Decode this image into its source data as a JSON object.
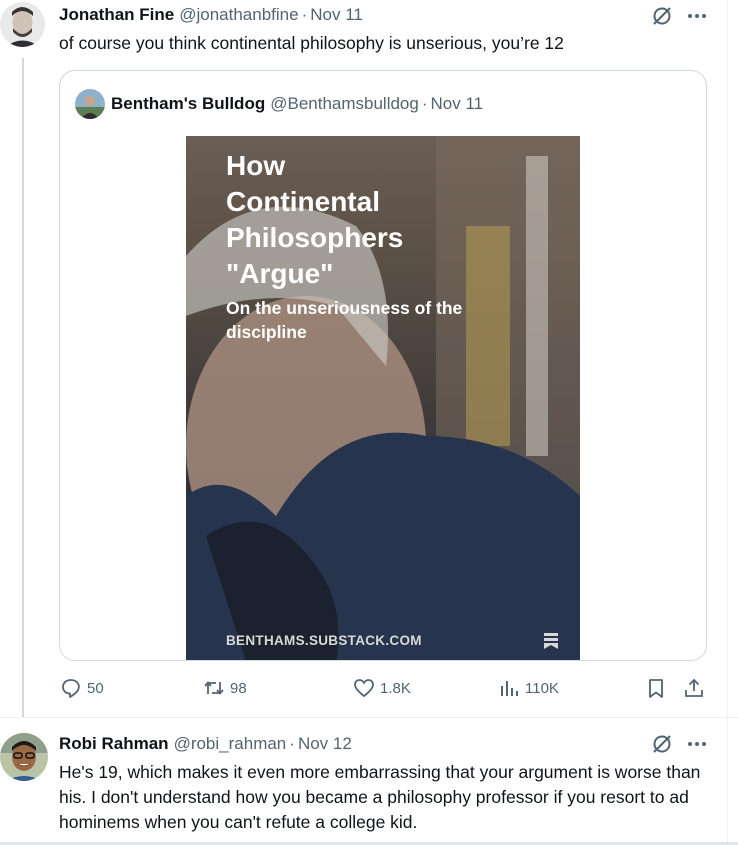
{
  "tweet1": {
    "author_name": "Jonathan Fine",
    "handle": "@jonathanbfine",
    "separator": "·",
    "date": "Nov 11",
    "text": "of course you think continental philosophy is unserious, you’re 12",
    "quote": {
      "author_name": "Bentham's Bulldog",
      "handle": "@Benthamsbulldog",
      "separator": "·",
      "date": "Nov 11",
      "media": {
        "title": "How\nContinental\nPhilosophers\n\"Argue\"",
        "subtitle": "On the unseriousness of the discipline",
        "footer": "BENTHAMS.SUBSTACK.COM"
      }
    },
    "actions": {
      "replies": "50",
      "reposts": "98",
      "likes": "1.8K",
      "views": "110K"
    }
  },
  "tweet2": {
    "author_name": "Robi Rahman",
    "handle": "@robi_rahman",
    "separator": "·",
    "date": "Nov 12",
    "text": "He's 19, which makes it even more embarrassing that your argument is worse than his. I don't understand how you became a philosophy professor if you resort to ad hominems when you can't refute a college kid."
  },
  "colors": {
    "text_primary": "#0f1419",
    "text_secondary": "#536471",
    "border": "#cfd9de"
  }
}
